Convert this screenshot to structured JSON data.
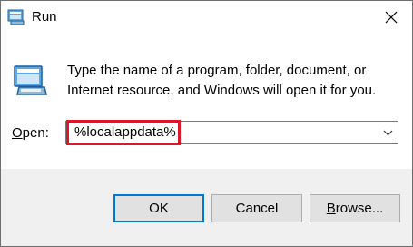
{
  "window": {
    "title": "Run",
    "title_icon": "run-app-icon",
    "close_icon": "close-icon"
  },
  "content": {
    "icon": "run-app-icon",
    "description_line1": "Type the name of a program, folder, document, or",
    "description_line2": "Internet resource, and Windows will open it for you."
  },
  "open_field": {
    "label_mnemonic": "O",
    "label_rest": "pen:",
    "value": "%localappdata%",
    "highlight_color": "#d9182a"
  },
  "buttons": {
    "ok": "OK",
    "cancel": "Cancel",
    "browse_mnemonic": "B",
    "browse_rest": "rowse..."
  },
  "colors": {
    "accent": "#0078d7",
    "footer_bg": "#f0f0f0"
  }
}
